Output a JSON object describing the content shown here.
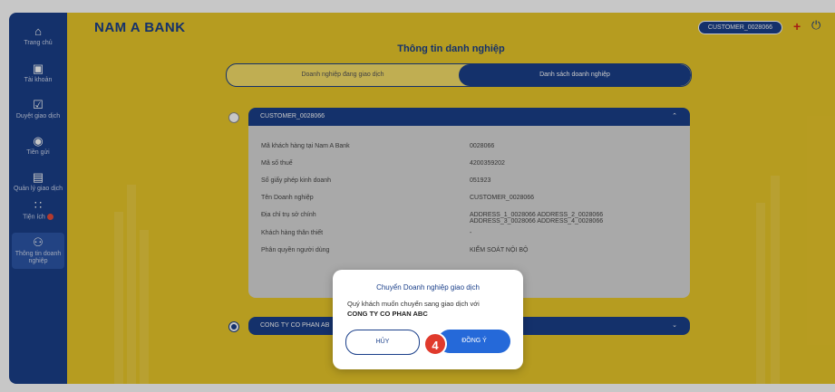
{
  "sidebar": {
    "items": [
      {
        "label": "Trang chủ",
        "icon": "home-icon"
      },
      {
        "label": "Tài khoản",
        "icon": "wallet-icon"
      },
      {
        "label": "Duyệt giao dịch",
        "icon": "check-box-icon"
      },
      {
        "label": "Tiền gửi",
        "icon": "savings-icon"
      },
      {
        "label": "Quản lý giao dịch",
        "icon": "document-icon"
      },
      {
        "label": "Tiện ích",
        "icon": "grid-icon"
      },
      {
        "label": "Thông tin doanh nghiệp",
        "icon": "people-icon"
      }
    ]
  },
  "header": {
    "brand": "NAM A BANK",
    "user": "CUSTOMER_0028066",
    "flag_icon": "vietnam-flag-icon",
    "power_icon": "power-icon"
  },
  "page": {
    "title": "Thông tin danh nghiệp",
    "tabs": [
      "Doanh nghiệp đang giao dịch",
      "Danh sách doanh nghiệp"
    ]
  },
  "cards": [
    {
      "name": "CUSTOMER_0028066",
      "rows": [
        {
          "label": "Mã khách hàng tại Nam A Bank",
          "value": "0028066"
        },
        {
          "label": "Mã số thuế",
          "value": "4200359202"
        },
        {
          "label": "Số giấy phép kinh doanh",
          "value": "051923"
        },
        {
          "label": "Tên Doanh nghiệp",
          "value": "CUSTOMER_0028066"
        },
        {
          "label": "Địa chỉ trụ sở chính",
          "value": "ADDRESS_1_0028066 ADDRESS_2_0028066",
          "value2": "ADDRESS_3_0028066 ADDRESS_4_0028066"
        },
        {
          "label": "Khách hàng thân thiết",
          "value": "-"
        },
        {
          "label": "Phân quyền người dùng",
          "value": "KIỂM SOÁT NỘI BỘ"
        }
      ]
    },
    {
      "name": "CONG TY CO PHAN AB"
    }
  ],
  "dialog": {
    "title": "Chuyển Doanh nghiệp giao dịch",
    "message": "Quý khách muốn chuyển sang giao dịch với",
    "company": "CONG TY CO PHAN ABC",
    "cancel": "HỦY",
    "ok": "ĐỒNG Ý"
  },
  "step_badge": "4",
  "colors": {
    "brand_blue": "#1a3f8a",
    "background_yellow": "#eac82a",
    "primary_button": "#2569d9",
    "badge_red": "#e03a2c"
  }
}
